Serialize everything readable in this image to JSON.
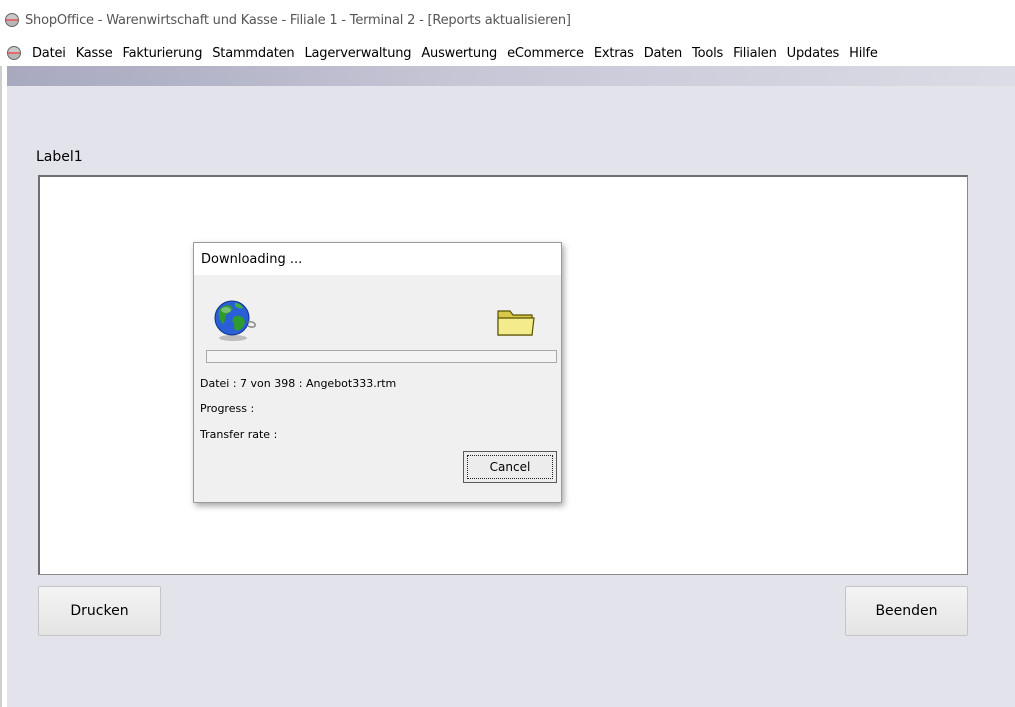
{
  "window": {
    "title": "ShopOffice - Warenwirtschaft und Kasse - Filiale 1 - Terminal 2 - [Reports aktualisieren]"
  },
  "menu": {
    "items": [
      "Datei",
      "Kasse",
      "Fakturierung",
      "Stammdaten",
      "Lagerverwaltung",
      "Auswertung",
      "eCommerce",
      "Extras",
      "Daten",
      "Tools",
      "Filialen",
      "Updates",
      "Hilfe"
    ]
  },
  "main": {
    "label": "Label1",
    "print_button": "Drucken",
    "close_button": "Beenden"
  },
  "dialog": {
    "title": "Downloading ...",
    "file_line": "Datei : 7 von 398 : Angebot333.rtm",
    "progress_label": "Progress :",
    "transfer_rate_label": "Transfer rate :",
    "cancel_label": "Cancel",
    "progress_fraction": 0,
    "icons": {
      "source": "globe-icon",
      "target": "folder-icon"
    }
  },
  "colors": {
    "client_bg": "#e3e3ec",
    "band_dark": "#a8a8bf"
  }
}
